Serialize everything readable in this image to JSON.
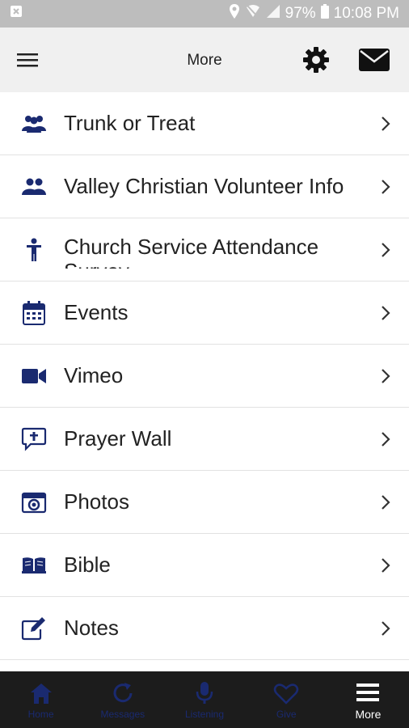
{
  "status_bar": {
    "battery": "97%",
    "time": "10:08 PM"
  },
  "header": {
    "title": "More"
  },
  "items": [
    {
      "label": "Trunk or Treat",
      "icon": "group-icon"
    },
    {
      "label": "Valley Christian Volunteer Info",
      "icon": "group-icon"
    },
    {
      "label": "Church Service Attendance Survey",
      "icon": "person-icon"
    },
    {
      "label": "Events",
      "icon": "calendar-icon"
    },
    {
      "label": "Vimeo",
      "icon": "video-camera-icon"
    },
    {
      "label": "Prayer Wall",
      "icon": "prayer-bubble-icon"
    },
    {
      "label": "Photos",
      "icon": "camera-icon"
    },
    {
      "label": "Bible",
      "icon": "book-icon"
    },
    {
      "label": "Notes",
      "icon": "edit-icon"
    }
  ],
  "tabs": [
    {
      "label": "Home",
      "icon": "home-icon"
    },
    {
      "label": "Messages",
      "icon": "refresh-icon"
    },
    {
      "label": "Listening",
      "icon": "microphone-icon"
    },
    {
      "label": "Give",
      "icon": "heart-icon"
    },
    {
      "label": "More",
      "icon": "menu-icon"
    }
  ],
  "colors": {
    "icon_navy": "#1a2a70",
    "tabbar_bg": "#1c1c1c",
    "header_bg": "#f0f0f0",
    "statusbar_bg": "#bdbdbd"
  }
}
